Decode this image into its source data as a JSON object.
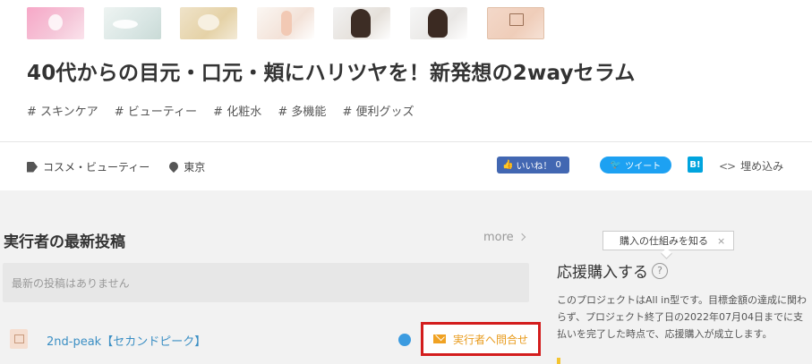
{
  "thumbnails": [
    "thumb-1",
    "thumb-2",
    "thumb-3",
    "thumb-4",
    "thumb-5",
    "thumb-6",
    "thumb-7"
  ],
  "project": {
    "title": "40代からの目元・口元・頬にハリツヤを！新発想の2wayセラム",
    "tags": [
      "# スキンケア",
      "# ビューティー",
      "# 化粧水",
      "# 多機能",
      "# 便利グッズ"
    ],
    "category": "コスメ・ビューティー",
    "location": "東京"
  },
  "share": {
    "like_label": "いいね！",
    "like_count": "0",
    "tweet_label": "ツイート",
    "hatena_label": "B!",
    "embed_label": "埋め込み"
  },
  "posts": {
    "title": "実行者の最新投稿",
    "more_label": "more",
    "empty_text": "最新の投稿はありません"
  },
  "owner": {
    "name": "2nd-peak【セカンドピーク】",
    "contact_label": "実行者へ問合せ"
  },
  "support": {
    "tooltip_label": "購入の仕組みを知る",
    "tooltip_close": "×",
    "title": "応援購入する",
    "help": "?",
    "description": "このプロジェクトはAll in型です。目標金額の達成に関わらず、プロジェクト終了日の2022年07月04日までに支払いを完了した時点で、応援購入が成立します。"
  },
  "colors": {
    "facebook": "#4267b2",
    "twitter": "#1da1f2",
    "hatena": "#00a4de",
    "contact_highlight": "#d31d1d",
    "contact_text": "#e89a1a"
  }
}
